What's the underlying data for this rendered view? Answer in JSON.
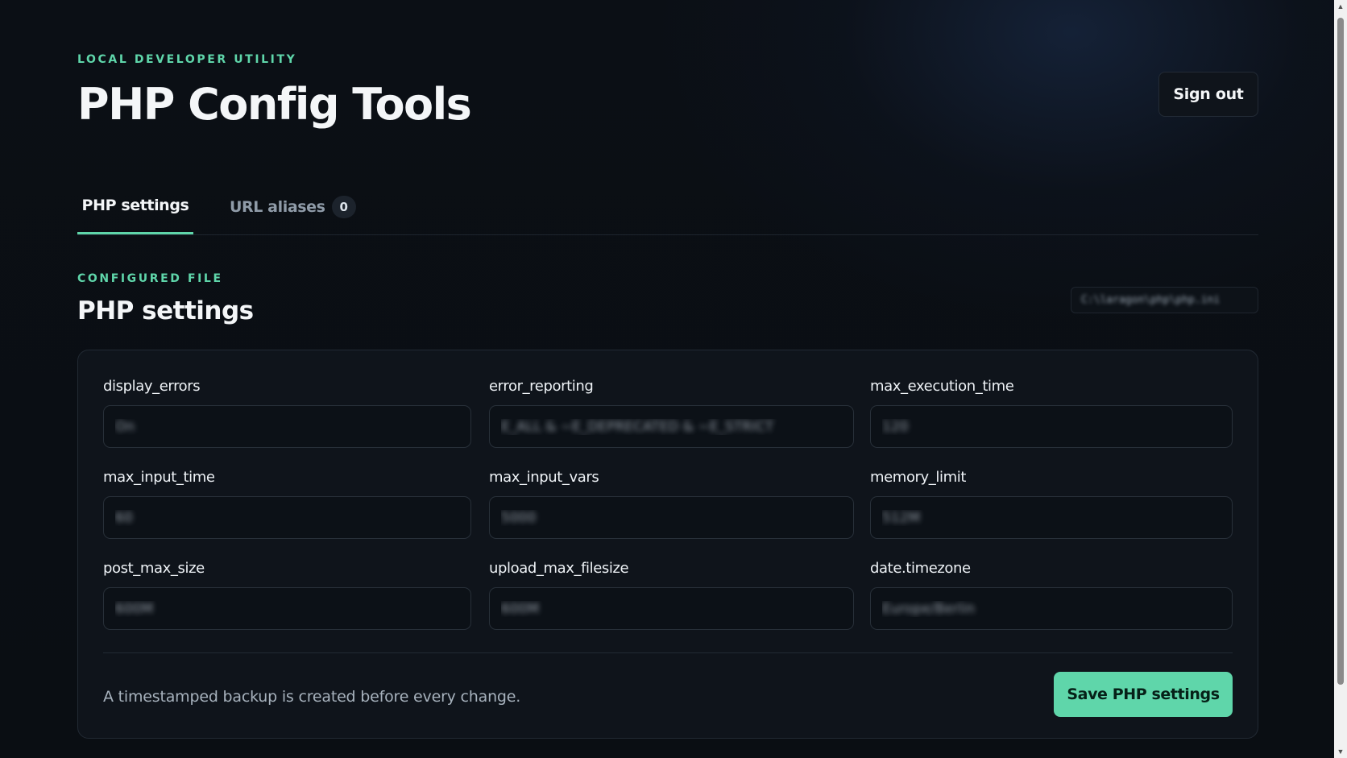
{
  "header": {
    "eyebrow": "LOCAL DEVELOPER UTILITY",
    "title": "PHP Config Tools",
    "sign_out_label": "Sign out"
  },
  "tabs": [
    {
      "label": "PHP settings",
      "active": true
    },
    {
      "label": "URL aliases",
      "active": false,
      "badge": "0"
    }
  ],
  "section": {
    "eyebrow": "CONFIGURED FILE",
    "title": "PHP settings",
    "file_path": "C:\\laragon\\php\\php.ini"
  },
  "fields": [
    {
      "name": "display_errors",
      "value": "On"
    },
    {
      "name": "error_reporting",
      "value": "E_ALL & ~E_DEPRECATED & ~E_STRICT"
    },
    {
      "name": "max_execution_time",
      "value": "120"
    },
    {
      "name": "max_input_time",
      "value": "60"
    },
    {
      "name": "max_input_vars",
      "value": "5000"
    },
    {
      "name": "memory_limit",
      "value": "512M"
    },
    {
      "name": "post_max_size",
      "value": "600M"
    },
    {
      "name": "upload_max_filesize",
      "value": "600M"
    },
    {
      "name": "date.timezone",
      "value": "Europe/Berlin"
    }
  ],
  "footer": {
    "note": "A timestamped backup is created before every change.",
    "save_label": "Save PHP settings"
  },
  "colors": {
    "accent": "#5fd6aa",
    "background": "#0a0e13",
    "card": "#10151c"
  },
  "icons": {
    "scroll_up": "triangle-up-icon",
    "scroll_down": "triangle-down-icon"
  }
}
